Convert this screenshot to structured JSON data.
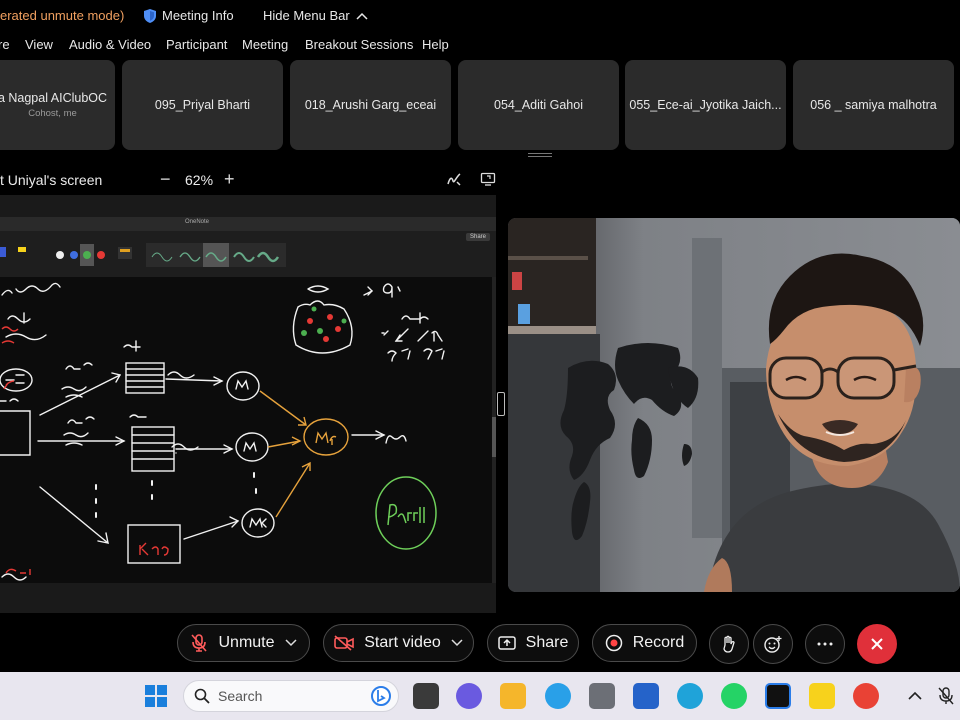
{
  "topbar": {
    "mode_text": "erated unmute mode)",
    "meeting_info": "Meeting Info",
    "hide_menu_bar": "Hide Menu Bar"
  },
  "menu": [
    "re",
    "View",
    "Audio & Video",
    "Participant",
    "Meeting",
    "Breakout Sessions",
    "Help"
  ],
  "participants": [
    {
      "name": "a Nagpal AIClubOC",
      "sub": "Cohost, me"
    },
    {
      "name": "095_Priyal Bharti",
      "sub": ""
    },
    {
      "name": "018_Arushi Garg_eceai",
      "sub": ""
    },
    {
      "name": "054_Aditi Gahoi",
      "sub": ""
    },
    {
      "name": "055_Ece-ai_Jyotika Jaich...",
      "sub": ""
    },
    {
      "name": "056 _ samiya malhotra",
      "sub": ""
    }
  ],
  "share": {
    "title": "t Uniyal's screen",
    "zoom_out": "−",
    "zoom_level": "62%",
    "zoom_in": "+"
  },
  "onenote": {
    "app_title": "OneNote",
    "share_label": "Share"
  },
  "controls": {
    "unmute": "Unmute",
    "start_video": "Start video",
    "share": "Share",
    "record": "Record"
  },
  "taskbar": {
    "search_placeholder": "Search"
  },
  "colors": {
    "end_button": "#e0303a",
    "mode_text": "#f0a060",
    "taskbar": "#e8e6ef"
  }
}
